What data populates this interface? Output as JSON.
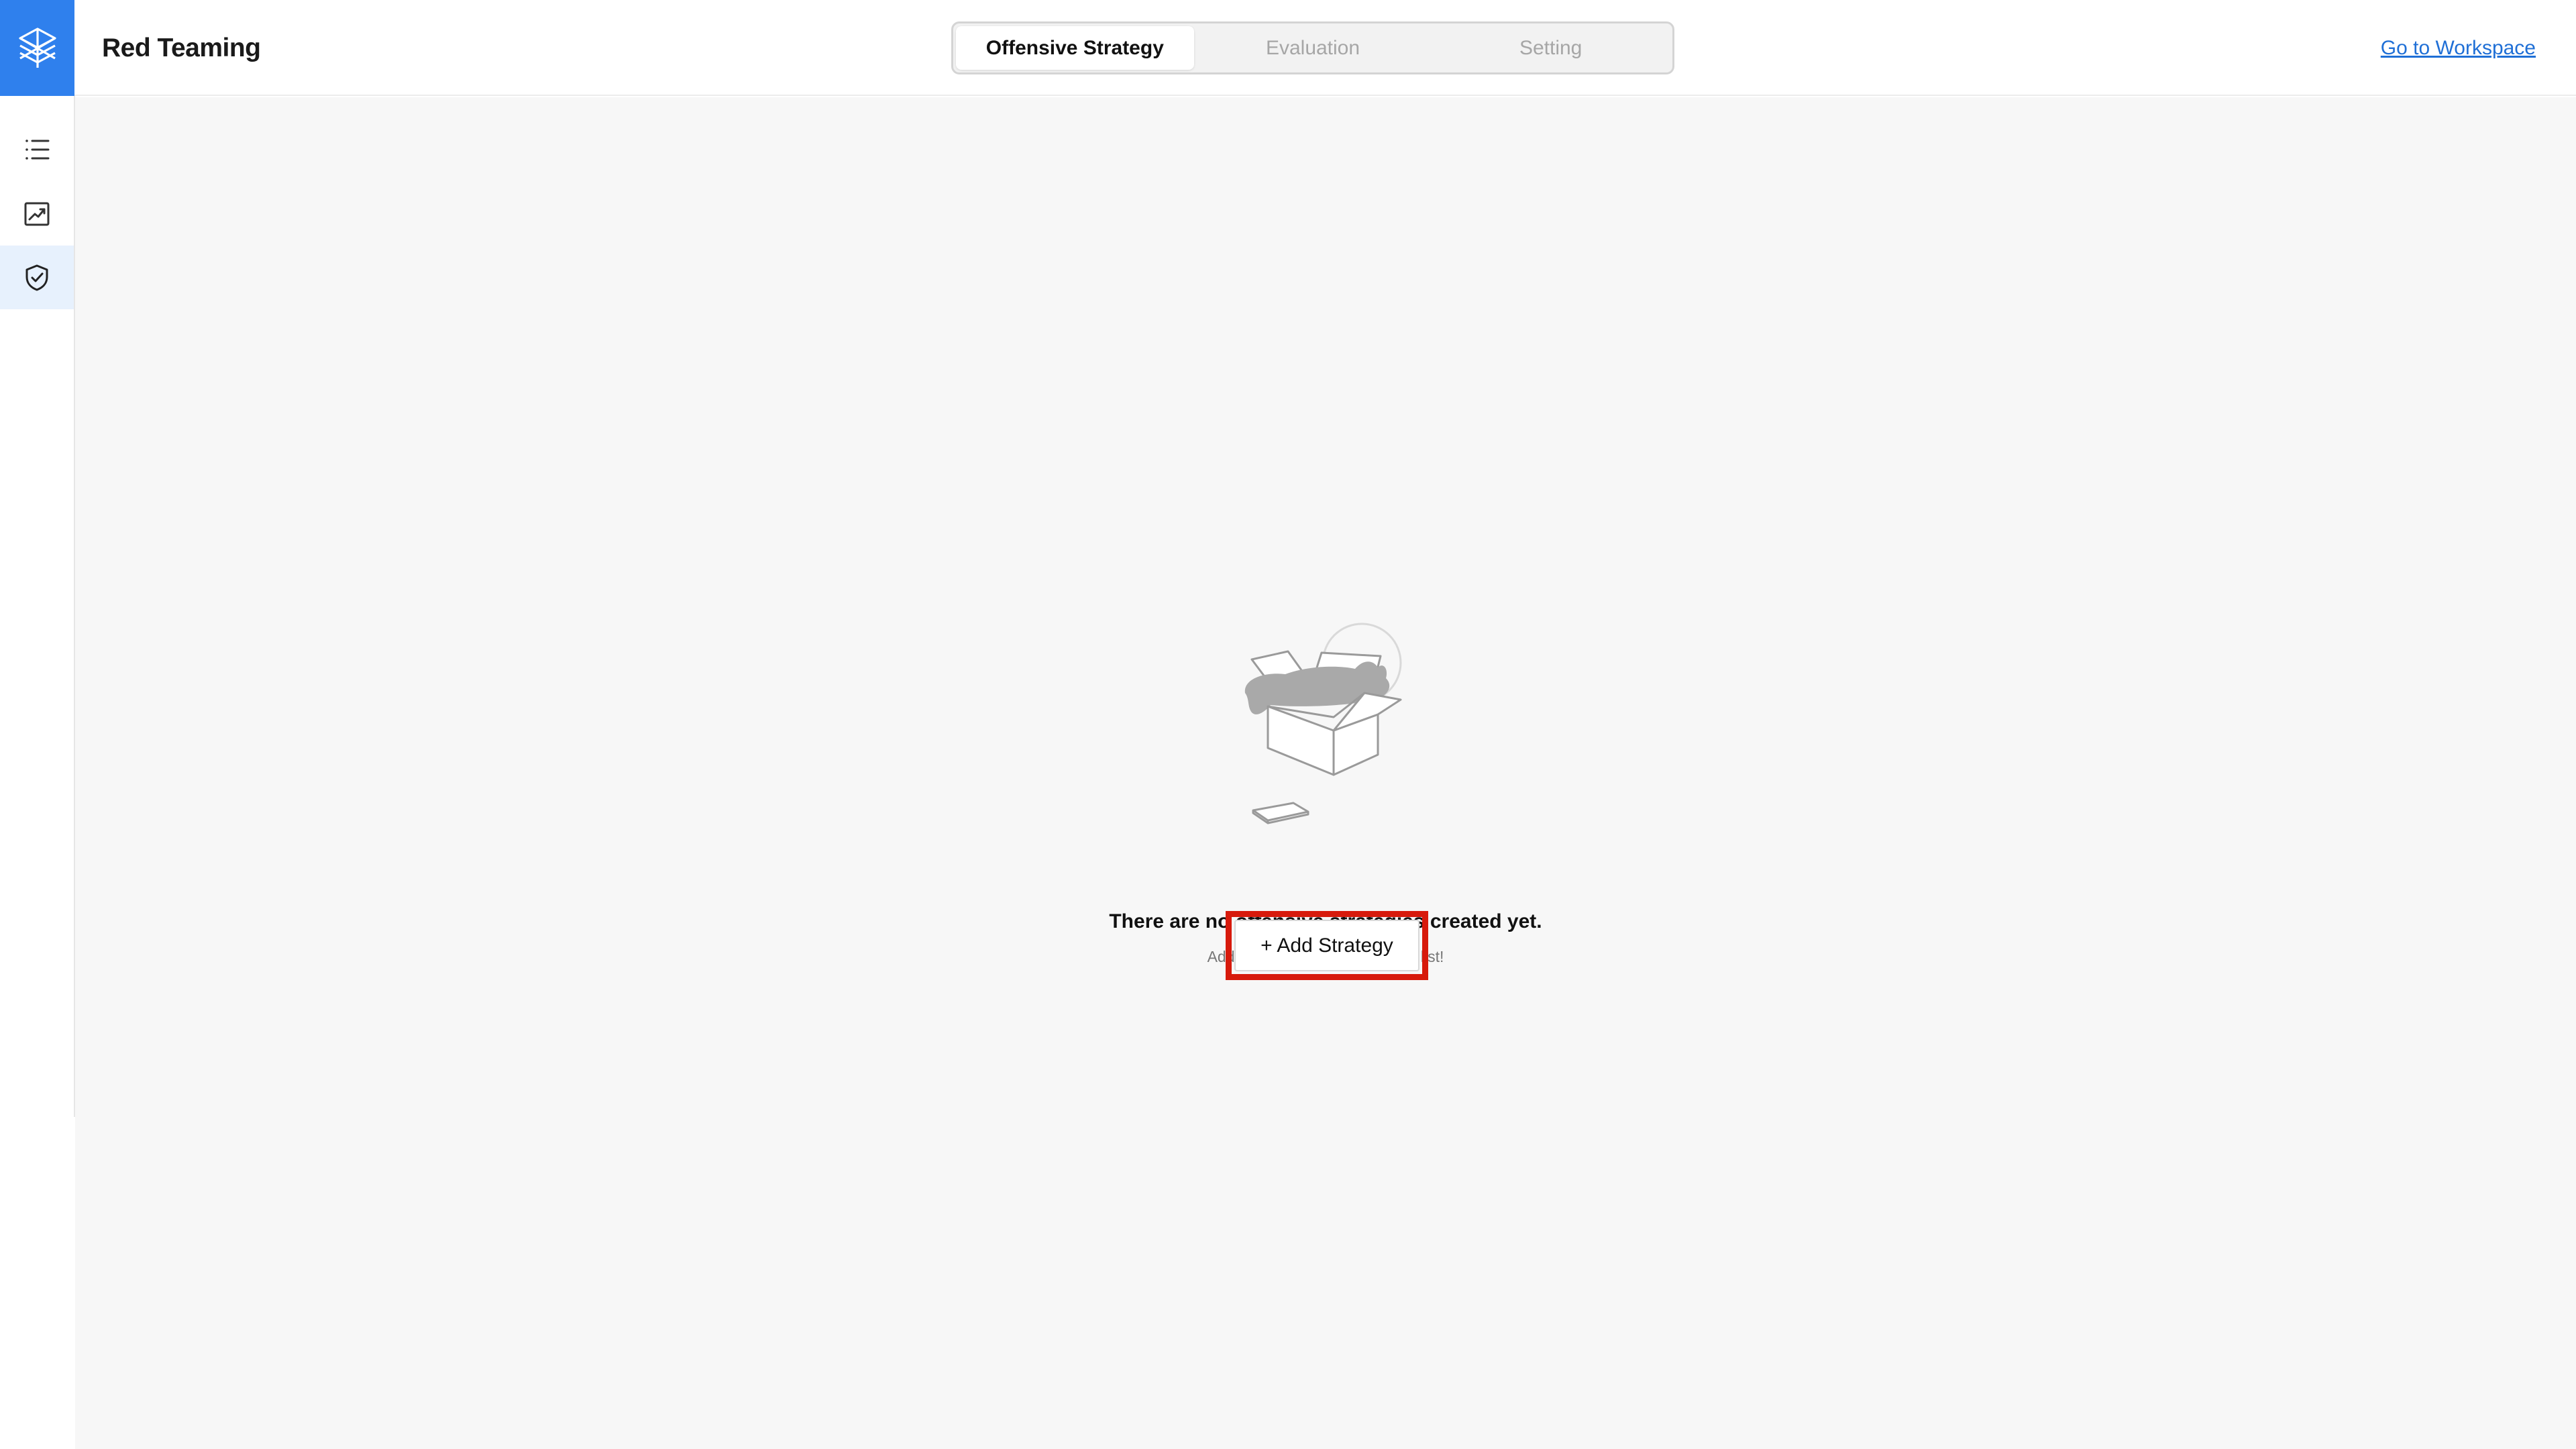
{
  "app": {
    "title": "Red Teaming",
    "brand_color": "#2f80ed",
    "logo_icon": "layers-logo-icon"
  },
  "header": {
    "tabs": [
      {
        "label": "Offensive Strategy",
        "active": true
      },
      {
        "label": "Evaluation",
        "active": false
      },
      {
        "label": "Setting",
        "active": false
      }
    ],
    "workspace_link": "Go to Workspace"
  },
  "sidebar": {
    "items": [
      {
        "icon": "list-icon",
        "active": false
      },
      {
        "icon": "chart-icon",
        "active": false
      },
      {
        "icon": "shield-check-icon",
        "active": true
      }
    ]
  },
  "main": {
    "empty_state": {
      "illustration": "empty-box-icon",
      "title": "There are no offensive strategies created yet.",
      "subtitle": "Add strategy now and manage list!",
      "button_label": "+ Add Strategy",
      "highlight_color": "#d71a0c"
    }
  }
}
